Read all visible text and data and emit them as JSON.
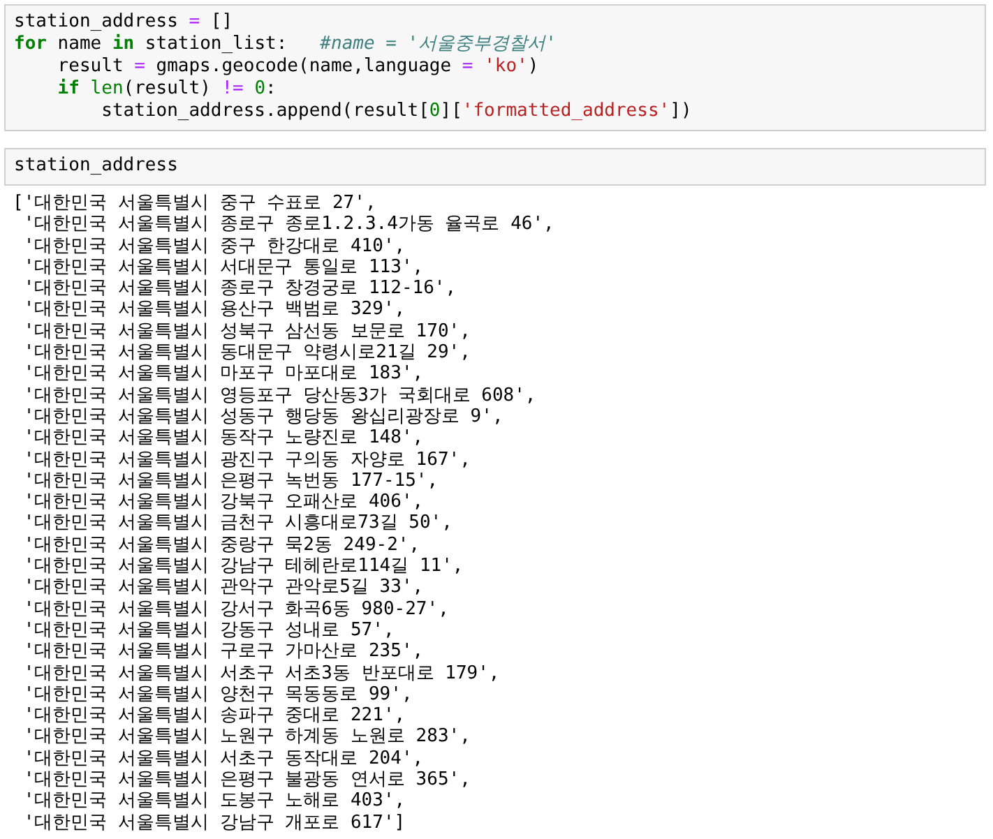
{
  "cells": [
    {
      "kind": "code",
      "lines": [
        [
          {
            "t": "station_address ",
            "kind": "plain"
          },
          {
            "t": "=",
            "kind": "op"
          },
          {
            "t": " []",
            "kind": "plain"
          }
        ],
        [
          {
            "t": "for",
            "kind": "kw"
          },
          {
            "t": " name ",
            "kind": "plain"
          },
          {
            "t": "in",
            "kind": "kw"
          },
          {
            "t": " station_list:   ",
            "kind": "plain"
          },
          {
            "t": "#name = '서울중부경찰서'",
            "kind": "comment"
          }
        ],
        [
          {
            "t": "    result ",
            "kind": "plain"
          },
          {
            "t": "=",
            "kind": "op"
          },
          {
            "t": " gmaps.geocode(name,language ",
            "kind": "plain"
          },
          {
            "t": "= ",
            "kind": "op"
          },
          {
            "t": "'ko'",
            "kind": "str"
          },
          {
            "t": ")",
            "kind": "plain"
          }
        ],
        [
          {
            "t": "    if ",
            "kind": "kw"
          },
          {
            "t": "len",
            "kind": "builtin"
          },
          {
            "t": "(result) ",
            "kind": "plain"
          },
          {
            "t": "!= ",
            "kind": "op"
          },
          {
            "t": "0",
            "kind": "num"
          },
          {
            "t": ":",
            "kind": "plain"
          }
        ],
        [
          {
            "t": "        station_address.append(result[",
            "kind": "plain"
          },
          {
            "t": "0",
            "kind": "num"
          },
          {
            "t": "][",
            "kind": "plain"
          },
          {
            "t": "'formatted_address'",
            "kind": "str"
          },
          {
            "t": "])",
            "kind": "plain"
          }
        ]
      ]
    },
    {
      "kind": "code",
      "lines": [
        [
          {
            "t": "station_address",
            "kind": "plain"
          }
        ]
      ],
      "output": [
        "['대한민국 서울특별시 중구 수표로 27',",
        " '대한민국 서울특별시 종로구 종로1.2.3.4가동 율곡로 46',",
        " '대한민국 서울특별시 중구 한강대로 410',",
        " '대한민국 서울특별시 서대문구 통일로 113',",
        " '대한민국 서울특별시 종로구 창경궁로 112-16',",
        " '대한민국 서울특별시 용산구 백범로 329',",
        " '대한민국 서울특별시 성북구 삼선동 보문로 170',",
        " '대한민국 서울특별시 동대문구 약령시로21길 29',",
        " '대한민국 서울특별시 마포구 마포대로 183',",
        " '대한민국 서울특별시 영등포구 당산동3가 국회대로 608',",
        " '대한민국 서울특별시 성동구 행당동 왕십리광장로 9',",
        " '대한민국 서울특별시 동작구 노량진로 148',",
        " '대한민국 서울특별시 광진구 구의동 자양로 167',",
        " '대한민국 서울특별시 은평구 녹번동 177-15',",
        " '대한민국 서울특별시 강북구 오패산로 406',",
        " '대한민국 서울특별시 금천구 시흥대로73길 50',",
        " '대한민국 서울특별시 중랑구 묵2동 249-2',",
        " '대한민국 서울특별시 강남구 테헤란로114길 11',",
        " '대한민국 서울특별시 관악구 관악로5길 33',",
        " '대한민국 서울특별시 강서구 화곡6동 980-27',",
        " '대한민국 서울특별시 강동구 성내로 57',",
        " '대한민국 서울특별시 구로구 가마산로 235',",
        " '대한민국 서울특별시 서초구 서초3동 반포대로 179',",
        " '대한민국 서울특별시 양천구 목동동로 99',",
        " '대한민국 서울특별시 송파구 중대로 221',",
        " '대한민국 서울특별시 노원구 하계동 노원로 283',",
        " '대한민국 서울특별시 서초구 동작대로 204',",
        " '대한민국 서울특별시 은평구 불광동 연서로 365',",
        " '대한민국 서울특별시 도봉구 노해로 403',",
        " '대한민국 서울특별시 강남구 개포로 617']"
      ]
    }
  ]
}
